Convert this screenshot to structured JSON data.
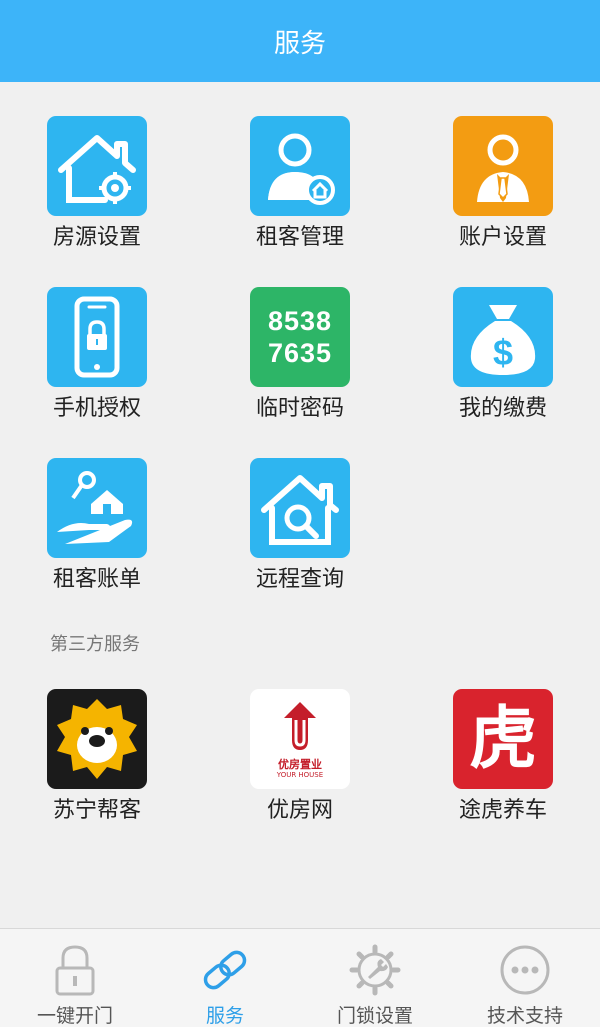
{
  "header": {
    "title": "服务"
  },
  "colors": {
    "header_bg": "#3db4f9",
    "tile_blue": "#2eb5f0",
    "tile_orange": "#f39c12",
    "tile_green": "#2db567",
    "tab_active": "#2e9fe8"
  },
  "services": [
    {
      "label": "房源设置",
      "icon": "house-gear-icon"
    },
    {
      "label": "租客管理",
      "icon": "tenant-person-icon"
    },
    {
      "label": "账户设置",
      "icon": "account-person-icon"
    },
    {
      "label": "手机授权",
      "icon": "phone-lock-icon"
    },
    {
      "label": "临时密码",
      "icon": "temp-code-icon",
      "code_line1": "8538",
      "code_line2": "7635"
    },
    {
      "label": "我的缴费",
      "icon": "money-bag-icon"
    },
    {
      "label": "租客账单",
      "icon": "hand-house-key-icon"
    },
    {
      "label": "远程查询",
      "icon": "house-search-icon"
    }
  ],
  "third_party": {
    "title": "第三方服务",
    "items": [
      {
        "label": "苏宁帮客",
        "icon": "suning-lion-logo"
      },
      {
        "label": "优房网",
        "icon": "youfang-logo",
        "logo_text": "优房置业",
        "logo_sub": "YOUR HOUSE"
      },
      {
        "label": "途虎养车",
        "icon": "tuhu-logo",
        "logo_text": "虎"
      }
    ]
  },
  "tabbar": {
    "tabs": [
      {
        "label": "一键开门",
        "icon": "padlock-icon",
        "active": false
      },
      {
        "label": "服务",
        "icon": "chain-link-icon",
        "active": true
      },
      {
        "label": "门锁设置",
        "icon": "gear-wrench-icon",
        "active": false
      },
      {
        "label": "技术支持",
        "icon": "more-dots-icon",
        "active": false
      }
    ]
  }
}
